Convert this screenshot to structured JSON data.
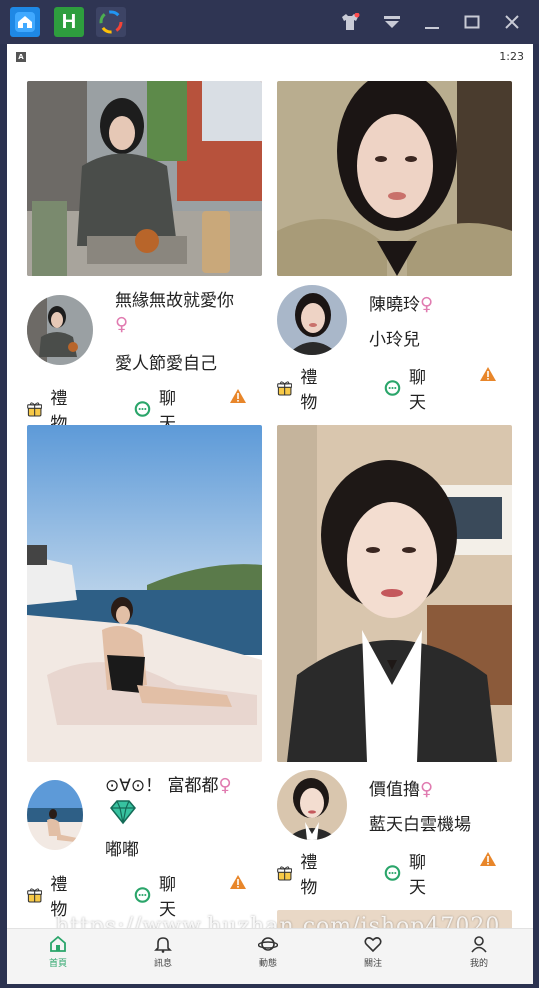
{
  "statusbar": {
    "time": "1:23",
    "indicator": "A"
  },
  "cards": [
    {
      "name": "無緣無故就愛你",
      "gender_icon": "♀",
      "subtitle": "愛人節愛自己"
    },
    {
      "name": "陳曉玲",
      "gender_icon": "♀",
      "subtitle": "小玲兒"
    },
    {
      "name": "⊙∀⊙！ 富都都",
      "gender_icon": "♀",
      "subtitle": "嘟嘟"
    },
    {
      "name": "價值擼",
      "gender_icon": "♀",
      "subtitle": "藍天白雲機場"
    }
  ],
  "actions": {
    "gift_label": "禮物",
    "chat_label": "聊天"
  },
  "nav": [
    {
      "label": "首頁"
    },
    {
      "label": "訊息"
    },
    {
      "label": "動態"
    },
    {
      "label": "關注"
    },
    {
      "label": "我的"
    }
  ],
  "watermark": "https://www.huzhan.com/ishop47020",
  "colors": {
    "accent_green": "#2aa56a",
    "female_pink": "#e07bb0",
    "warning": "#e8862a",
    "window_frame": "#2f3553"
  }
}
